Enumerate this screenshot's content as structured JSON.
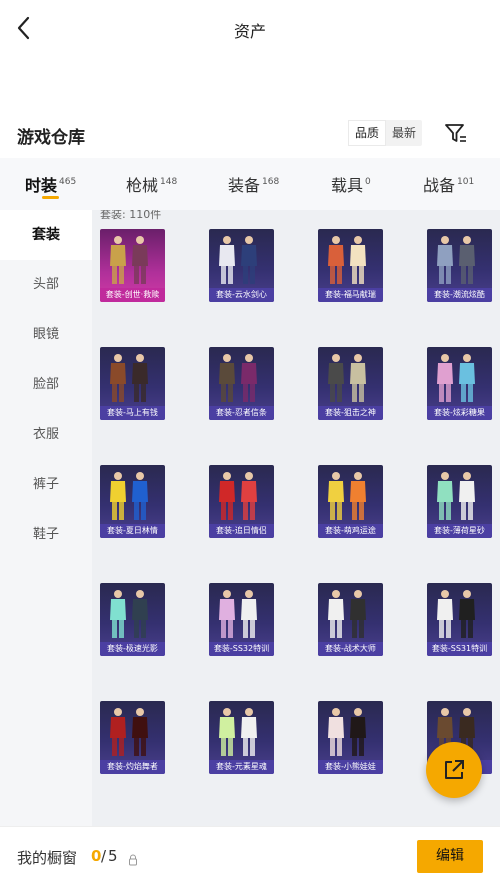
{
  "header": {
    "title": "资产"
  },
  "warehouse": {
    "title": "游戏仓库",
    "sort": [
      "品质",
      "最新"
    ]
  },
  "tabs": [
    {
      "label": "时装",
      "count": "465"
    },
    {
      "label": "枪械",
      "count": "148"
    },
    {
      "label": "装备",
      "count": "168"
    },
    {
      "label": "载具",
      "count": "0"
    },
    {
      "label": "战备",
      "count": "101"
    }
  ],
  "sidebar": [
    "套装",
    "头部",
    "眼镜",
    "脸部",
    "衣服",
    "裤子",
    "鞋子"
  ],
  "content": {
    "count_text": "套装: 110件"
  },
  "items": [
    {
      "label": "套装-创世·救赎",
      "quality": "pink"
    },
    {
      "label": "套装-云水剑心",
      "quality": "purple"
    },
    {
      "label": "套装-福马献瑞",
      "quality": "purple"
    },
    {
      "label": "套装-潮流炫酷",
      "quality": "purple"
    },
    {
      "label": "套装-马上有钱",
      "quality": "purple"
    },
    {
      "label": "套装-忍者信条",
      "quality": "purple"
    },
    {
      "label": "套装-狙击之神",
      "quality": "purple"
    },
    {
      "label": "套装-炫彩糖果",
      "quality": "purple"
    },
    {
      "label": "套装-夏日林情",
      "quality": "purple"
    },
    {
      "label": "套装-追日情侣",
      "quality": "purple"
    },
    {
      "label": "套装-萌鸡运途",
      "quality": "purple"
    },
    {
      "label": "套装-薄荷星砂",
      "quality": "purple"
    },
    {
      "label": "套装-极速光影",
      "quality": "purple"
    },
    {
      "label": "套装-SS32特训",
      "quality": "purple"
    },
    {
      "label": "套装-战术大师",
      "quality": "purple"
    },
    {
      "label": "套装-SS31特训",
      "quality": "purple"
    },
    {
      "label": "套装-灼焰舞者",
      "quality": "purple"
    },
    {
      "label": "套装-元素星魂",
      "quality": "purple"
    },
    {
      "label": "套装-小熊娃娃",
      "quality": "purple"
    },
    {
      "label": "套装-",
      "quality": "purple"
    }
  ],
  "showcase": {
    "label": "我的橱窗",
    "current": "0",
    "separator": "/",
    "max": "5",
    "edit_label": "编辑"
  },
  "colors": {
    "accent": "#f5a800",
    "card_purple": "#4b3fa2",
    "card_pink": "#c02a9c"
  },
  "icons": [
    "back-arrow-icon",
    "filter-icon",
    "lock-icon",
    "share-icon"
  ]
}
